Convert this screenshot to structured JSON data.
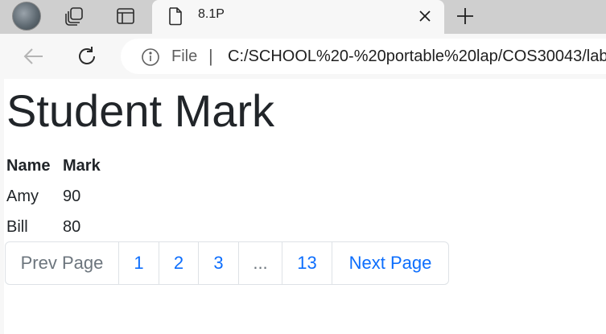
{
  "browser": {
    "tab": {
      "title": "8.1P",
      "close_icon": "close-icon"
    },
    "address": {
      "info_icon": "info-icon",
      "scheme_label": "File",
      "separator": "|",
      "url": "C:/SCHOOL%20-%20portable%20lap/COS30043/lab"
    }
  },
  "page": {
    "heading": "Student Mark",
    "table": {
      "headers": [
        "Name",
        "Mark"
      ],
      "rows": [
        [
          "Amy",
          "90"
        ],
        [
          "Bill",
          "80"
        ]
      ]
    },
    "pagination": {
      "prev": "Prev Page",
      "pages": [
        "1",
        "2",
        "3"
      ],
      "ellipsis": "...",
      "last": "13",
      "next": "Next Page"
    }
  },
  "colors": {
    "link": "#0d6efd",
    "muted": "#6c757d",
    "text": "#212529",
    "tabstrip": "#cfcfcf"
  }
}
